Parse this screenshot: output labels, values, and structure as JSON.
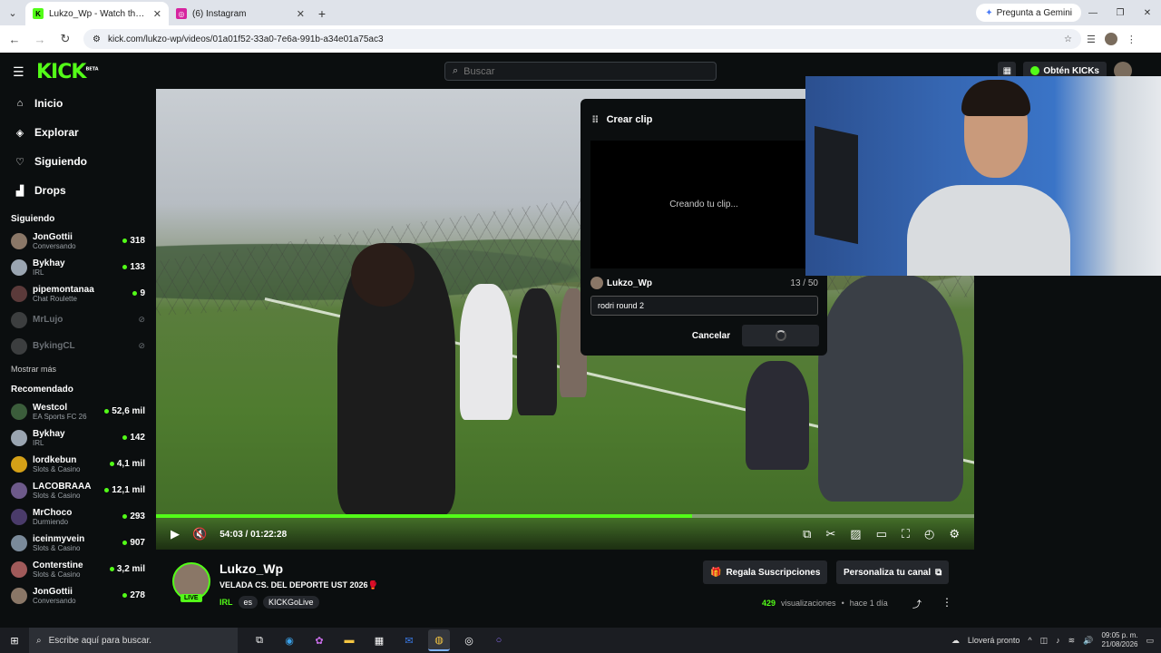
{
  "browser": {
    "tabs": [
      {
        "title": "Lukzo_Wp - Watch the VOD on",
        "active": true,
        "favicon": "kick"
      },
      {
        "title": "(6) Instagram",
        "active": false,
        "favicon": "instagram"
      }
    ],
    "gemini_label": "Pregunta a Gemini",
    "url": "kick.com/lukzo-wp/videos/01a01f52-33a0-7e6a-991b-a34e01a75ac3"
  },
  "topbar": {
    "logo": "KICK",
    "logo_badge": "BETA",
    "search_placeholder": "Buscar",
    "kicks_label": "Obtén KICKs"
  },
  "sidebar": {
    "nav": [
      {
        "label": "Inicio",
        "icon": "home-icon"
      },
      {
        "label": "Explorar",
        "icon": "compass-icon"
      },
      {
        "label": "Siguiendo",
        "icon": "heart-icon"
      },
      {
        "label": "Drops",
        "icon": "drops-icon"
      }
    ],
    "following_title": "Siguiendo",
    "following": [
      {
        "name": "JonGottii",
        "category": "Conversando",
        "viewers": "318",
        "color": "#8a7767"
      },
      {
        "name": "Bykhay",
        "category": "IRL",
        "viewers": "133",
        "color": "#9aa5b1"
      },
      {
        "name": "pipemontanaa",
        "category": "Chat Roulette",
        "viewers": "9",
        "color": "#5b3a3a"
      },
      {
        "name": "MrLujo",
        "category": "",
        "viewers": "",
        "color": "#888"
      },
      {
        "name": "BykingCL",
        "category": "",
        "viewers": "",
        "color": "#888"
      }
    ],
    "show_more": "Mostrar más",
    "recommended_title": "Recomendado",
    "recommended": [
      {
        "name": "Westcol",
        "category": "EA Sports FC 26",
        "viewers": "52,6 mil",
        "color": "#3b5d3b"
      },
      {
        "name": "Bykhay",
        "category": "IRL",
        "viewers": "142",
        "color": "#9aa5b1"
      },
      {
        "name": "lordkebun",
        "category": "Slots & Casino",
        "viewers": "4,1 mil",
        "color": "#d4a017"
      },
      {
        "name": "LACOBRAAA",
        "category": "Slots & Casino",
        "viewers": "12,1 mil",
        "color": "#6d5a8a"
      },
      {
        "name": "MrChoco",
        "category": "Durmiendo",
        "viewers": "293",
        "color": "#4a3b6a"
      },
      {
        "name": "iceinmyvein",
        "category": "Slots & Casino",
        "viewers": "907",
        "color": "#7a8a9a"
      },
      {
        "name": "Conterstine",
        "category": "Slots & Casino",
        "viewers": "3,2 mil",
        "color": "#a05a5a"
      },
      {
        "name": "JonGottii",
        "category": "Conversando",
        "viewers": "278",
        "color": "#8a7767"
      }
    ]
  },
  "player": {
    "time_current": "54:03",
    "time_total": "01:22:28",
    "progress": 0.655
  },
  "clip": {
    "title": "Crear clip",
    "status": "Creando tu clip...",
    "user": "Lukzo_Wp",
    "char_count": "13 / 50",
    "input_value": "rodri round 2",
    "cancel_label": "Cancelar"
  },
  "channel": {
    "username": "Lukzo_Wp",
    "live_badge": "LIVE",
    "video_title": "VELADA CS. DEL DEPORTE UST 2026",
    "title_emoji": "🥊",
    "category": "IRL",
    "tags": [
      "es",
      "KICKGoLive"
    ],
    "subs_button": "Regala Suscripciones",
    "customize_button": "Personaliza tu canal",
    "views_count": "429",
    "views_label": "visualizaciones",
    "uploaded": "hace 1 día",
    "separator": "•"
  },
  "taskbar": {
    "search_placeholder": "Escribe aquí para buscar.",
    "weather": "Lloverá pronto",
    "time": "09:05 p. m.",
    "date": "21/08/2026"
  },
  "colors": {
    "accent": "#53fc18",
    "background": "#0b0e0f",
    "button": "#24272c"
  }
}
